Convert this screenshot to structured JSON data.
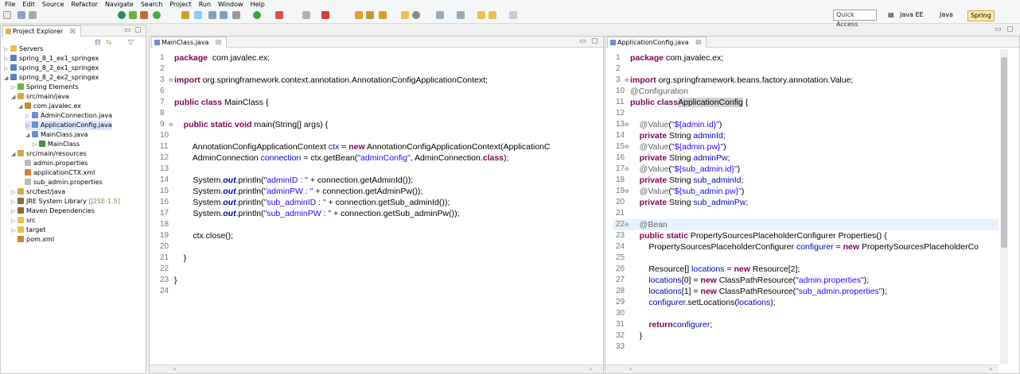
{
  "menu": [
    "File",
    "Edit",
    "Source",
    "Refactor",
    "Navigate",
    "Search",
    "Project",
    "Run",
    "Window",
    "Help"
  ],
  "toolbar": {
    "quick_access": "Quick Access",
    "perspectives": [
      "Java EE",
      "Java",
      "Spring"
    ],
    "active_perspective": "Spring"
  },
  "explorer": {
    "title": "Project Explorer",
    "items": [
      {
        "label": "Servers",
        "indent": 0,
        "icon": "folder-icon",
        "arrow": "▷"
      },
      {
        "label": "spring_8_1_ex1_springex",
        "indent": 0,
        "icon": "project-icon",
        "arrow": "▷"
      },
      {
        "label": "spring_8_2_ex1_springex",
        "indent": 0,
        "icon": "project-icon",
        "arrow": "▷"
      },
      {
        "label": "spring_8_2_ex2_springex",
        "indent": 0,
        "icon": "project-icon",
        "arrow": "◢"
      },
      {
        "label": "Spring Elements",
        "indent": 1,
        "icon": "spring-icon",
        "arrow": "▷"
      },
      {
        "label": "src/main/java",
        "indent": 1,
        "icon": "source-folder-icon",
        "arrow": "◢"
      },
      {
        "label": "com.javalec.ex",
        "indent": 2,
        "icon": "package-icon",
        "arrow": "◢"
      },
      {
        "label": "AdminConnection.java",
        "indent": 3,
        "icon": "java-file-icon",
        "arrow": "▷"
      },
      {
        "label": "ApplicationConfig.java",
        "indent": 3,
        "icon": "java-file-icon",
        "arrow": "▷",
        "selected": true
      },
      {
        "label": "MainClass.java",
        "indent": 3,
        "icon": "java-file-icon",
        "arrow": "◢"
      },
      {
        "label": "MainClass",
        "indent": 4,
        "icon": "class-icon",
        "arrow": "▷"
      },
      {
        "label": "src/main/resources",
        "indent": 1,
        "icon": "source-folder-icon",
        "arrow": "◢"
      },
      {
        "label": "admin.properties",
        "indent": 2,
        "icon": "file-icon",
        "arrow": ""
      },
      {
        "label": "applicationCTX.xml",
        "indent": 2,
        "icon": "xml-file-icon",
        "arrow": ""
      },
      {
        "label": "sub_admin.properties",
        "indent": 2,
        "icon": "file-icon",
        "arrow": ""
      },
      {
        "label": "src/test/java",
        "indent": 1,
        "icon": "source-folder-icon",
        "arrow": "▷"
      },
      {
        "label": "JRE System Library",
        "suffix": " [J2SE-1.5]",
        "indent": 1,
        "icon": "library-icon",
        "arrow": "▷"
      },
      {
        "label": "Maven Dependencies",
        "indent": 1,
        "icon": "library-icon",
        "arrow": "▷"
      },
      {
        "label": "src",
        "indent": 1,
        "icon": "folder-icon",
        "arrow": "▷"
      },
      {
        "label": "target",
        "indent": 1,
        "icon": "folder-icon",
        "arrow": "▷"
      },
      {
        "label": "pom.xml",
        "indent": 1,
        "icon": "xml-file-icon",
        "arrow": ""
      }
    ]
  },
  "editor_left": {
    "tab": "MainClass.java",
    "lines": [
      {
        "n": "1",
        "parts": [
          [
            "kw",
            "package"
          ],
          [
            "",
            "  com.javalec.ex;"
          ]
        ]
      },
      {
        "n": "2",
        "parts": []
      },
      {
        "n": "3",
        "parts": [
          [
            "kw",
            "import"
          ],
          [
            "",
            " org.springframework.context.annotation.AnnotationConfigApplicationContext;"
          ]
        ],
        "fold": true
      },
      {
        "n": "6",
        "parts": []
      },
      {
        "n": "7",
        "parts": [
          [
            "kw",
            "public class"
          ],
          [
            "",
            " MainClass {"
          ]
        ]
      },
      {
        "n": "8",
        "parts": []
      },
      {
        "n": "9",
        "parts": [
          [
            "",
            "    "
          ],
          [
            "kw",
            "public static void"
          ],
          [
            "",
            " main(String[] args) {"
          ]
        ],
        "fold": true
      },
      {
        "n": "10",
        "parts": []
      },
      {
        "n": "11",
        "parts": [
          [
            "",
            "        AnnotationConfigApplicationContext "
          ],
          [
            "fld",
            "ctx"
          ],
          [
            "",
            " = "
          ],
          [
            "kw",
            "new"
          ],
          [
            "",
            " AnnotationConfigApplicationContext(ApplicationC"
          ]
        ]
      },
      {
        "n": "12",
        "parts": [
          [
            "",
            "        AdminConnection "
          ],
          [
            "fld",
            "connection"
          ],
          [
            "",
            " = ctx.getBean("
          ],
          [
            "str",
            "\"adminConfig\""
          ],
          [
            "",
            ", AdminConnection."
          ],
          [
            "kw",
            "class"
          ],
          [
            "",
            ");"
          ]
        ]
      },
      {
        "n": "13",
        "parts": []
      },
      {
        "n": "14",
        "parts": [
          [
            "",
            "        System."
          ],
          [
            "stat",
            "out"
          ],
          [
            "",
            ".println("
          ],
          [
            "str",
            "\"adminID : \""
          ],
          [
            "",
            " + connection.getAdminId());"
          ]
        ]
      },
      {
        "n": "15",
        "parts": [
          [
            "",
            "        System."
          ],
          [
            "stat",
            "out"
          ],
          [
            "",
            ".println("
          ],
          [
            "str",
            "\"adminPW : \""
          ],
          [
            "",
            " + connection.getAdminPw());"
          ]
        ]
      },
      {
        "n": "16",
        "parts": [
          [
            "",
            "        System."
          ],
          [
            "stat",
            "out"
          ],
          [
            "",
            ".println("
          ],
          [
            "str",
            "\"sub_adminID : \""
          ],
          [
            "",
            " + connection.getSub_adminId());"
          ]
        ]
      },
      {
        "n": "17",
        "parts": [
          [
            "",
            "        System."
          ],
          [
            "stat",
            "out"
          ],
          [
            "",
            ".println("
          ],
          [
            "str",
            "\"sub_adminPW : \""
          ],
          [
            "",
            " + connection.getSub_adminPw());"
          ]
        ]
      },
      {
        "n": "18",
        "parts": []
      },
      {
        "n": "19",
        "parts": [
          [
            "",
            "        ctx.close();"
          ]
        ]
      },
      {
        "n": "20",
        "parts": []
      },
      {
        "n": "21",
        "parts": [
          [
            "",
            "    }"
          ]
        ]
      },
      {
        "n": "22",
        "parts": []
      },
      {
        "n": "23",
        "parts": [
          [
            "",
            "}"
          ]
        ]
      },
      {
        "n": "24",
        "parts": []
      }
    ]
  },
  "editor_right": {
    "tab": "ApplicationConfig.java",
    "lines": [
      {
        "n": "1",
        "parts": [
          [
            "kw",
            "package"
          ],
          [
            "",
            " com.javalec.ex;"
          ]
        ]
      },
      {
        "n": "2",
        "parts": []
      },
      {
        "n": "3",
        "parts": [
          [
            "kw",
            "import"
          ],
          [
            "",
            " org.springframework.beans.factory.annotation.Value;"
          ]
        ],
        "fold": true
      },
      {
        "n": "10",
        "parts": [
          [
            "ann",
            "@Configuration"
          ]
        ]
      },
      {
        "n": "11",
        "parts": [
          [
            "kw",
            "public class"
          ],
          [
            " ",
            ""
          ],
          [
            "occ",
            "ApplicationConfig"
          ],
          [
            "",
            " {"
          ]
        ]
      },
      {
        "n": "12",
        "parts": []
      },
      {
        "n": "13",
        "parts": [
          [
            "ann",
            "    @Value"
          ],
          [
            "",
            "("
          ],
          [
            "str",
            "\"${admin.id}\""
          ],
          [
            "",
            ")"
          ]
        ],
        "fold": true
      },
      {
        "n": "14",
        "parts": [
          [
            "kw",
            "    private"
          ],
          [
            "",
            " String "
          ],
          [
            "fld",
            "adminId"
          ],
          [
            "",
            ";"
          ]
        ]
      },
      {
        "n": "15",
        "parts": [
          [
            "ann",
            "    @Value"
          ],
          [
            "",
            "("
          ],
          [
            "str",
            "\"${admin.pw}\""
          ],
          [
            "",
            ")"
          ]
        ],
        "fold": true
      },
      {
        "n": "16",
        "parts": [
          [
            "kw",
            "    private"
          ],
          [
            "",
            " String "
          ],
          [
            "fld",
            "adminPw"
          ],
          [
            "",
            ";"
          ]
        ]
      },
      {
        "n": "17",
        "parts": [
          [
            "ann",
            "    @Value"
          ],
          [
            "",
            "("
          ],
          [
            "str",
            "\"${sub_admin.id}\""
          ],
          [
            "",
            ")"
          ]
        ],
        "fold": true
      },
      {
        "n": "18",
        "parts": [
          [
            "kw",
            "    private"
          ],
          [
            "",
            " String "
          ],
          [
            "fld",
            "sub_adminId"
          ],
          [
            "",
            ";"
          ]
        ]
      },
      {
        "n": "19",
        "parts": [
          [
            "ann",
            "    @Value"
          ],
          [
            "",
            "("
          ],
          [
            "str",
            "\"${sub_admin.pw}\""
          ],
          [
            "",
            ")"
          ]
        ],
        "fold": true
      },
      {
        "n": "20",
        "parts": [
          [
            "kw",
            "    private"
          ],
          [
            "",
            " String "
          ],
          [
            "fld",
            "sub_adminPw"
          ],
          [
            "",
            ";"
          ]
        ]
      },
      {
        "n": "21",
        "parts": []
      },
      {
        "n": "22",
        "parts": [
          [
            "ann",
            "    @Bean"
          ]
        ],
        "fold": true,
        "current": true
      },
      {
        "n": "23",
        "parts": [
          [
            "kw",
            "    public static"
          ],
          [
            "",
            " PropertySourcesPlaceholderConfigurer Properties() {"
          ]
        ]
      },
      {
        "n": "24",
        "parts": [
          [
            "",
            "        PropertySourcesPlaceholderConfigurer "
          ],
          [
            "fld",
            "configurer"
          ],
          [
            "",
            " = "
          ],
          [
            "kw",
            "new"
          ],
          [
            "",
            " PropertySourcesPlaceholderCo"
          ]
        ]
      },
      {
        "n": "25",
        "parts": []
      },
      {
        "n": "26",
        "parts": [
          [
            "",
            "        Resource[] "
          ],
          [
            "fld",
            "locations"
          ],
          [
            "",
            " = "
          ],
          [
            "kw",
            "new"
          ],
          [
            "",
            " Resource[2];"
          ]
        ]
      },
      {
        "n": "27",
        "parts": [
          [
            "fld",
            "        locations"
          ],
          [
            "",
            "[0] = "
          ],
          [
            "kw",
            "new"
          ],
          [
            "",
            " ClassPathResource("
          ],
          [
            "str",
            "\"admin.properties\""
          ],
          [
            "",
            ");"
          ]
        ]
      },
      {
        "n": "28",
        "parts": [
          [
            "fld",
            "        locations"
          ],
          [
            "",
            "[1] = "
          ],
          [
            "kw",
            "new"
          ],
          [
            "",
            " ClassPathResource("
          ],
          [
            "str",
            "\"sub_admin.properties\""
          ],
          [
            "",
            ");"
          ]
        ]
      },
      {
        "n": "29",
        "parts": [
          [
            "fld",
            "        configurer"
          ],
          [
            "",
            ".setLocations("
          ],
          [
            "fld",
            "locations"
          ],
          [
            "",
            ");"
          ]
        ]
      },
      {
        "n": "30",
        "parts": []
      },
      {
        "n": "31",
        "parts": [
          [
            "kw",
            "        return"
          ],
          [
            " ",
            ""
          ],
          [
            "fld",
            "configurer"
          ],
          [
            "",
            ";"
          ]
        ]
      },
      {
        "n": "32",
        "parts": [
          [
            "",
            "    }"
          ]
        ]
      },
      {
        "n": "33",
        "parts": []
      }
    ]
  }
}
